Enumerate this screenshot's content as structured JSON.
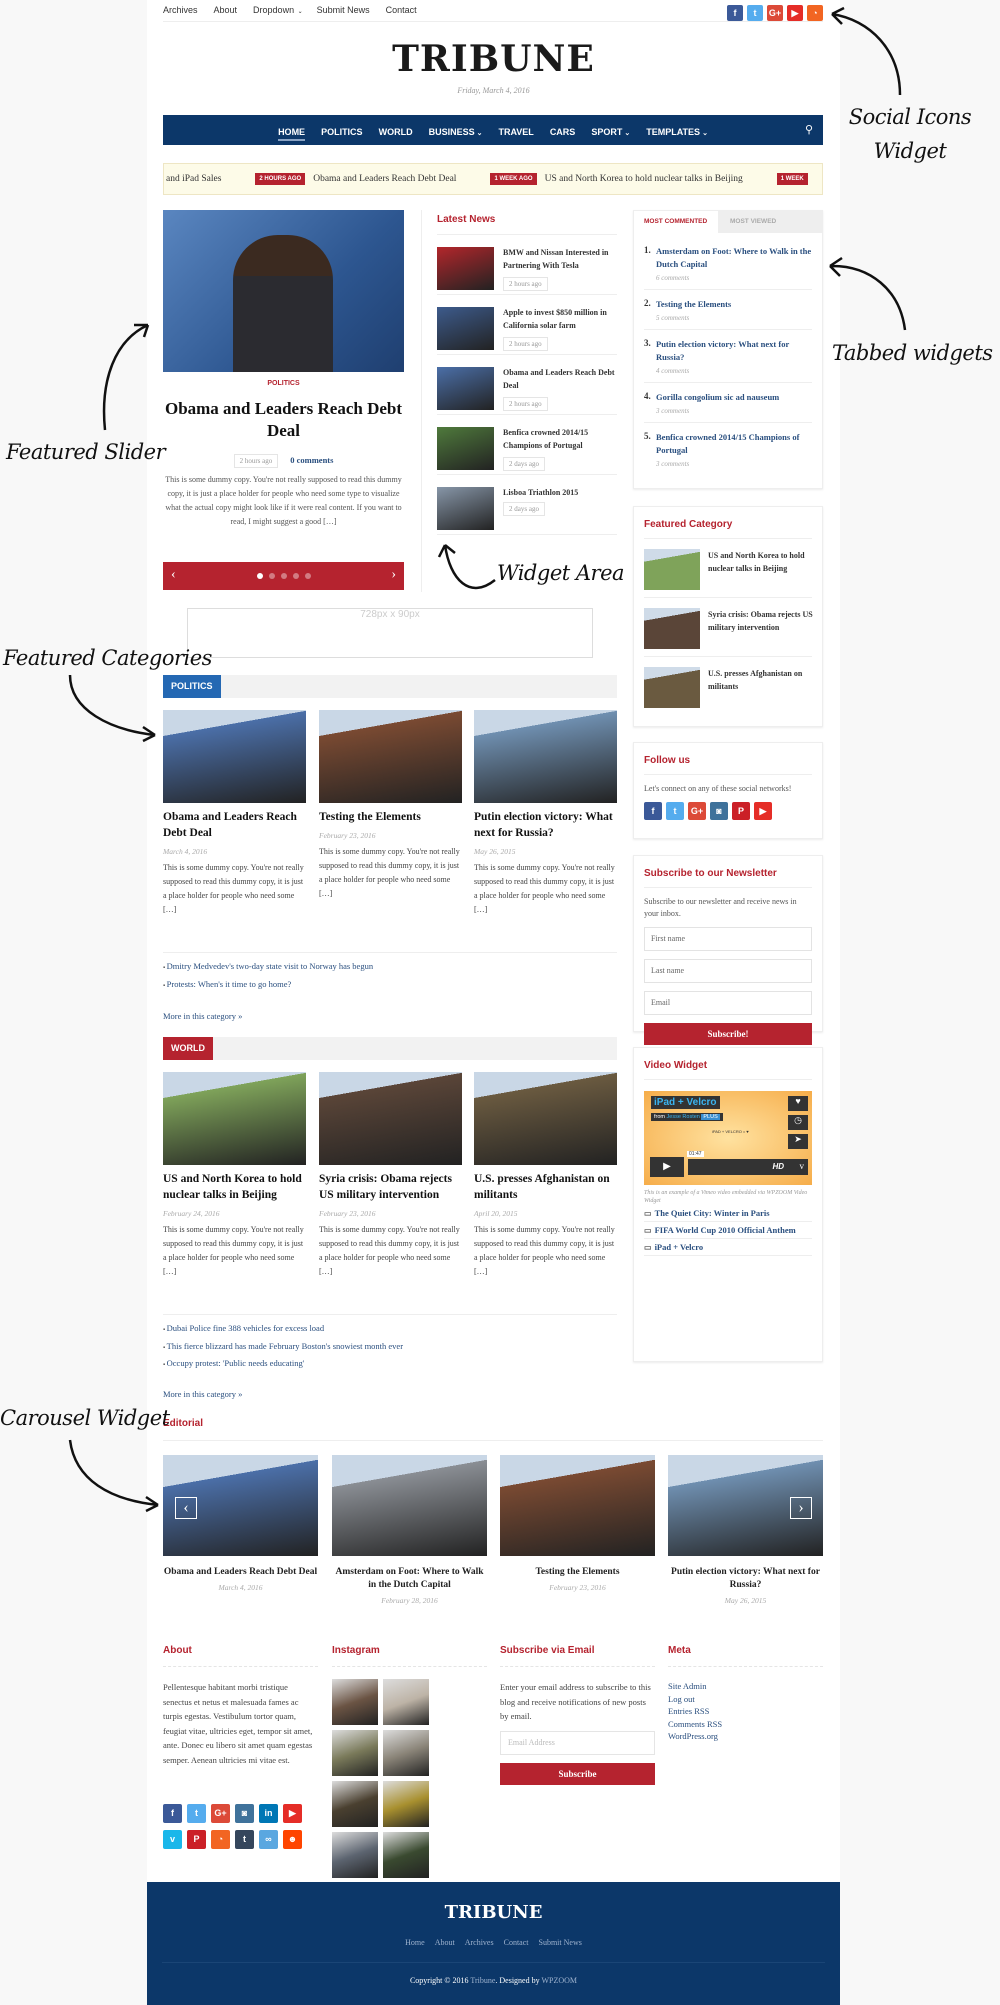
{
  "topbar": {
    "links": [
      {
        "label": "Archives"
      },
      {
        "label": "About"
      },
      {
        "label": "Dropdown",
        "dropdown": true
      },
      {
        "label": "Submit News"
      },
      {
        "label": "Contact"
      }
    ],
    "social": [
      {
        "icon": "facebook-icon",
        "glyph": "f",
        "color": "#3b5998"
      },
      {
        "icon": "twitter-icon",
        "glyph": "t",
        "color": "#55acee"
      },
      {
        "icon": "google-plus-icon",
        "glyph": "G+",
        "color": "#dc4a38"
      },
      {
        "icon": "youtube-icon",
        "glyph": "▶",
        "color": "#e52d27"
      },
      {
        "icon": "rss-icon",
        "glyph": "◔",
        "color": "#f26522"
      }
    ]
  },
  "header": {
    "logo": "TRIBUNE",
    "date": "Friday, March 4, 2016"
  },
  "nav": {
    "items": [
      {
        "label": "HOME",
        "active": true
      },
      {
        "label": "POLITICS"
      },
      {
        "label": "WORLD"
      },
      {
        "label": "BUSINESS",
        "dropdown": true
      },
      {
        "label": "TRAVEL"
      },
      {
        "label": "CARS"
      },
      {
        "label": "SPORT",
        "dropdown": true
      },
      {
        "label": "TEMPLATES",
        "dropdown": true
      }
    ],
    "search_icon": "search-icon"
  },
  "ticker": {
    "items": [
      {
        "badge": "",
        "title": "and iPad Sales"
      },
      {
        "badge": "2 HOURS AGO",
        "title": "Obama and Leaders Reach Debt Deal"
      },
      {
        "badge": "1 WEEK AGO",
        "title": "US and North Korea to hold nuclear talks in Beijing"
      },
      {
        "badge": "1 WEEK",
        "title": ""
      }
    ]
  },
  "slider": {
    "category": "POLITICS",
    "title": "Obama and Leaders Reach Debt Deal",
    "time": "2 hours ago",
    "comments": "0 comments",
    "excerpt": "This is some dummy copy. You're not really supposed to read this dummy copy, it is just a place holder for people who need some type to visualize what the actual copy might look like if it were real content. If you want to read, I might suggest a good […]",
    "slide_count": 5,
    "active_slide": 1
  },
  "latest_news": {
    "title": "Latest News",
    "items": [
      {
        "title": "BMW and Nissan Interested in Partnering With Tesla",
        "time": "2 hours ago",
        "img": "#b3262b"
      },
      {
        "title": "Apple to invest $850 million in California solar farm",
        "time": "2 hours ago",
        "img": "#3d5b8c"
      },
      {
        "title": "Obama and Leaders Reach Debt Deal",
        "time": "2 hours ago",
        "img": "#4b6fa8"
      },
      {
        "title": "Benfica crowned 2014/15 Champions of Portugal",
        "time": "2 days ago",
        "img": "#4f7a3c"
      },
      {
        "title": "Lisboa Triathlon 2015",
        "time": "2 days ago",
        "img": "#8796a8"
      }
    ]
  },
  "tabs": {
    "tab_labels": [
      "MOST COMMENTED",
      "MOST VIEWED"
    ],
    "active_tab": 0,
    "items": [
      {
        "title": "Amsterdam on Foot: Where to Walk in the Dutch Capital",
        "comments": "6 comments"
      },
      {
        "title": "Testing the Elements",
        "comments": "5 comments"
      },
      {
        "title": "Putin election victory: What next for Russia?",
        "comments": "4 comments"
      },
      {
        "title": "Gorilla congolium sic ad nauseum",
        "comments": "3 comments"
      },
      {
        "title": "Benfica crowned 2014/15 Champions of Portugal",
        "comments": "3 comments"
      }
    ]
  },
  "featured_category": {
    "title": "Featured Category",
    "items": [
      {
        "title": "US and North Korea to hold nuclear talks in Beijing",
        "img": "#7fa35a"
      },
      {
        "title": "Syria crisis: Obama rejects US military intervention",
        "img": "#5a4538"
      },
      {
        "title": "U.S. presses Afghanistan on militants",
        "img": "#6a5a40"
      }
    ]
  },
  "follow_us": {
    "title": "Follow us",
    "text": "Let's connect on any of these social networks!",
    "icons": [
      {
        "icon": "facebook-icon",
        "glyph": "f",
        "color": "#3b5998"
      },
      {
        "icon": "twitter-icon",
        "glyph": "t",
        "color": "#55acee"
      },
      {
        "icon": "google-plus-icon",
        "glyph": "G+",
        "color": "#dc4a38"
      },
      {
        "icon": "instagram-icon",
        "glyph": "◙",
        "color": "#3f729b"
      },
      {
        "icon": "pinterest-icon",
        "glyph": "P",
        "color": "#cb2027"
      },
      {
        "icon": "youtube-icon",
        "glyph": "▶",
        "color": "#e52d27"
      }
    ]
  },
  "newsletter": {
    "title": "Subscribe to our Newsletter",
    "text": "Subscribe to our newsletter and receive news in your inbox.",
    "first_name_placeholder": "First name",
    "last_name_placeholder": "Last name",
    "email_placeholder": "Email",
    "button": "Subscribe!"
  },
  "video_widget": {
    "title": "Video Widget",
    "video_title": "iPad + Velcro",
    "video_from": "from",
    "video_author": "Jesse Rosten",
    "video_badge": "PLUS",
    "video_caption": "iPAD + VELCRO = ♥",
    "video_time": "01:47",
    "video_hd": "HD",
    "note": "This is an example of a Vimeo video embedded via WPZOOM Video Widget",
    "items": [
      {
        "title": "The Quiet City: Winter in Paris"
      },
      {
        "title": "FIFA World Cup 2010 Official Anthem"
      },
      {
        "title": "iPad + Velcro"
      }
    ]
  },
  "ad": {
    "text": "728px x 90px"
  },
  "politics": {
    "label": "POLITICS",
    "color": "#2468b3",
    "posts": [
      {
        "title": "Obama and Leaders Reach Debt Deal",
        "date": "March 4, 2016",
        "excerpt": "This is some dummy copy. You're not really supposed to read this dummy copy, it is just a place holder for people who need some […]",
        "img": "#4b6fa8"
      },
      {
        "title": "Testing the Elements",
        "date": "February 23, 2016",
        "excerpt": "This is some dummy copy. You're not really supposed to read this dummy copy, it is just a place holder for people who need some […]",
        "img": "#7a4a32"
      },
      {
        "title": "Putin election victory: What next for Russia?",
        "date": "May 26, 2015",
        "excerpt": "This is some dummy copy. You're not really supposed to read this dummy copy, it is just a place holder for people who need some […]",
        "img": "#6f8fb0"
      }
    ],
    "links": [
      "Dmitry Medvedev's two-day state visit to Norway has begun",
      "Protests: When's it time to go home?"
    ],
    "more": "More in this category »"
  },
  "world": {
    "label": "WORLD",
    "color": "#b5232f",
    "posts": [
      {
        "title": "US and North Korea to hold nuclear talks in Beijing",
        "date": "February 24, 2016",
        "excerpt": "This is some dummy copy. You're not really supposed to read this dummy copy, it is just a place holder for people who need some […]",
        "img": "#7fa35a"
      },
      {
        "title": "Syria crisis: Obama rejects US military intervention",
        "date": "February 23, 2016",
        "excerpt": "This is some dummy copy. You're not really supposed to read this dummy copy, it is just a place holder for people who need some […]",
        "img": "#5a4538"
      },
      {
        "title": "U.S. presses Afghanistan on militants",
        "date": "April 20, 2015",
        "excerpt": "This is some dummy copy. You're not really supposed to read this dummy copy, it is just a place holder for people who need some […]",
        "img": "#6a5a40"
      }
    ],
    "links": [
      "Dubai Police fine 388 vehicles for excess load",
      "This fierce blizzard has made February Boston's snowiest month ever",
      "Occupy protest: 'Public needs educating'"
    ],
    "more": "More in this category »"
  },
  "editorial": {
    "title": "Editorial",
    "items": [
      {
        "title": "Obama and Leaders Reach Debt Deal",
        "date": "March 4, 2016",
        "img": "#4b6fa8"
      },
      {
        "title": "Amsterdam on Foot: Where to Walk in the Dutch Capital",
        "date": "February 28, 2016",
        "img": "#8a8e94"
      },
      {
        "title": "Testing the Elements",
        "date": "February 23, 2016",
        "img": "#7a4a32"
      },
      {
        "title": "Putin election victory: What next for Russia?",
        "date": "May 26, 2015",
        "img": "#6f8fb0"
      }
    ]
  },
  "footer_widgets": {
    "about": {
      "title": "About",
      "text": "Pellentesque habitant morbi tristique senectus et netus et malesuada fames ac turpis egestas. Vestibulum tortor quam, feugiat vitae, ultricies eget, tempor sit amet, ante. Donec eu libero sit amet quam egestas semper. Aenean ultricies mi vitae est.",
      "icons": [
        {
          "icon": "facebook-icon",
          "glyph": "f",
          "color": "#3b5998"
        },
        {
          "icon": "twitter-icon",
          "glyph": "t",
          "color": "#55acee"
        },
        {
          "icon": "google-plus-icon",
          "glyph": "G+",
          "color": "#dc4a38"
        },
        {
          "icon": "instagram-icon",
          "glyph": "◙",
          "color": "#3f729b"
        },
        {
          "icon": "linkedin-icon",
          "glyph": "in",
          "color": "#0077b5"
        },
        {
          "icon": "youtube-icon",
          "glyph": "▶",
          "color": "#e52d27"
        },
        {
          "icon": "vimeo-icon",
          "glyph": "v",
          "color": "#1ab7ea"
        },
        {
          "icon": "pinterest-icon",
          "glyph": "P",
          "color": "#cb2027"
        },
        {
          "icon": "rss-icon",
          "glyph": "◔",
          "color": "#f26522"
        },
        {
          "icon": "tumblr-icon",
          "glyph": "t",
          "color": "#35465c"
        },
        {
          "icon": "flickr-icon",
          "glyph": "∞",
          "color": "#5aa7e0"
        },
        {
          "icon": "reddit-icon",
          "glyph": "☻",
          "color": "#ff4500"
        }
      ]
    },
    "instagram": {
      "title": "Instagram",
      "photos": [
        "#6b5444",
        "#bdb3a6",
        "#7a7a5a",
        "#8a8478",
        "#4a4030",
        "#a8902f",
        "#5c6470",
        "#3a4a30",
        "#7a5240"
      ]
    },
    "subscribe": {
      "title": "Subscribe via Email",
      "text": "Enter your email address to subscribe to this blog and receive notifications of new posts by email.",
      "placeholder": "Email Address",
      "button": "Subscribe"
    },
    "meta": {
      "title": "Meta",
      "links": [
        "Site Admin",
        "Log out",
        "Entries RSS",
        "Comments RSS",
        "WordPress.org"
      ]
    }
  },
  "footer": {
    "logo": "TRIBUNE",
    "links": [
      "Home",
      "About",
      "Archives",
      "Contact",
      "Submit News"
    ],
    "copyright_prefix": "Copyright © 2016",
    "site": "Tribune",
    "designed_by": ". Designed by",
    "designer": "WPZOOM"
  },
  "annotations": {
    "social": "Social Icons Widget",
    "tabbed": "Tabbed widgets",
    "slider": "Featured Slider",
    "widget_area": "Widget Area",
    "categories": "Featured Categories",
    "carousel": "Carousel Widget"
  },
  "colors": {
    "nav": "#0c3769",
    "accent": "#b5232f",
    "link": "#2a4f7f",
    "footer": "#0c3769"
  }
}
